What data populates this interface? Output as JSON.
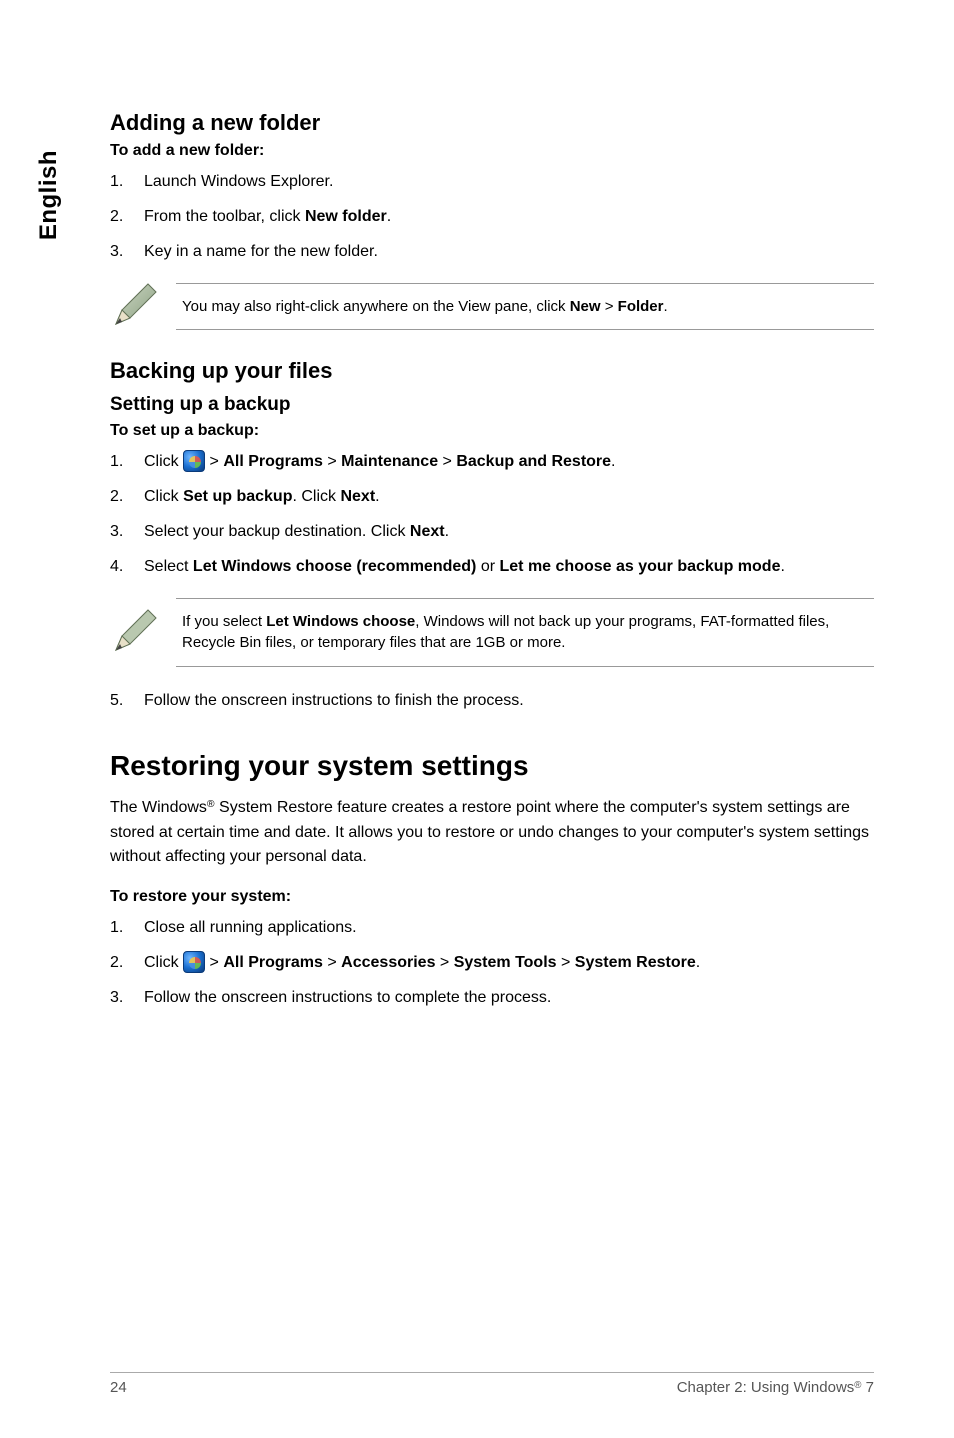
{
  "sideTab": "English",
  "section1": {
    "heading": "Adding a new folder",
    "lead": "To add a new folder:",
    "steps": [
      {
        "num": "1.",
        "text": "Launch Windows Explorer."
      },
      {
        "num": "2.",
        "parts": [
          {
            "t": "From the toolbar, click "
          },
          {
            "b": "New folder"
          },
          {
            "t": "."
          }
        ]
      },
      {
        "num": "3.",
        "text": "Key in a name for the new folder."
      }
    ],
    "note": {
      "parts": [
        {
          "t": "You may also right-click anywhere on the View pane, click "
        },
        {
          "b": "New"
        },
        {
          "t": " > "
        },
        {
          "b": "Folder"
        },
        {
          "t": "."
        }
      ]
    }
  },
  "section2": {
    "heading": "Backing up your files",
    "subheading": "Setting up a backup",
    "lead": "To set up a backup:",
    "steps": [
      {
        "num": "1.",
        "parts": [
          {
            "t": "Click "
          },
          {
            "orb": true
          },
          {
            "t": " > "
          },
          {
            "b": "All Programs"
          },
          {
            "t": " > "
          },
          {
            "b": "Maintenance"
          },
          {
            "t": " > "
          },
          {
            "b": "Backup and Restore"
          },
          {
            "t": "."
          }
        ]
      },
      {
        "num": "2.",
        "parts": [
          {
            "t": "Click "
          },
          {
            "b": "Set up backup"
          },
          {
            "t": ". Click "
          },
          {
            "b": "Next"
          },
          {
            "t": "."
          }
        ]
      },
      {
        "num": "3.",
        "parts": [
          {
            "t": "Select your backup destination. Click "
          },
          {
            "b": "Next"
          },
          {
            "t": "."
          }
        ]
      },
      {
        "num": "4.",
        "parts": [
          {
            "t": "Select "
          },
          {
            "b": "Let Windows choose (recommended)"
          },
          {
            "t": " or "
          },
          {
            "b": "Let me choose as your backup mode"
          },
          {
            "t": "."
          }
        ]
      }
    ],
    "note": {
      "parts": [
        {
          "t": "If you select "
        },
        {
          "b": "Let Windows choose"
        },
        {
          "t": ", Windows will not back up your programs, FAT-formatted files, Recycle Bin files, or temporary files that are 1GB or more."
        }
      ]
    },
    "steps2": [
      {
        "num": "5.",
        "text": "Follow the onscreen instructions to finish the process."
      }
    ]
  },
  "section3": {
    "title": "Restoring your system settings",
    "para": {
      "parts": [
        {
          "t": "The Windows"
        },
        {
          "sup": "®"
        },
        {
          "t": " System Restore feature creates a restore point where the computer's system settings are stored at certain time and date. It allows you to restore or undo changes to your computer's system settings without affecting your personal data."
        }
      ]
    },
    "lead": "To restore your system:",
    "steps": [
      {
        "num": "1.",
        "text": "Close all running applications."
      },
      {
        "num": "2.",
        "parts": [
          {
            "t": "Click "
          },
          {
            "orb": true
          },
          {
            "t": " > "
          },
          {
            "b": "All Programs"
          },
          {
            "t": " > "
          },
          {
            "b": "Accessories"
          },
          {
            "t": " > "
          },
          {
            "b": "System Tools"
          },
          {
            "t": " > "
          },
          {
            "b": "System Restore"
          },
          {
            "t": "."
          }
        ]
      },
      {
        "num": "3.",
        "text": "Follow the onscreen instructions to complete the process."
      }
    ]
  },
  "footer": {
    "page": "24",
    "right": {
      "parts": [
        {
          "t": "Chapter 2: Using Windows"
        },
        {
          "sup": "®"
        },
        {
          "t": " 7"
        }
      ]
    }
  }
}
